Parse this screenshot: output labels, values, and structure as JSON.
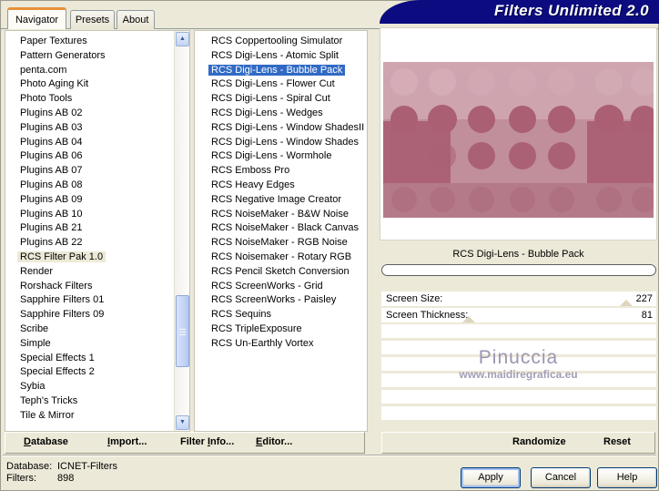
{
  "banner": {
    "title": "Filters Unlimited 2.0"
  },
  "tabs": [
    {
      "label": "Navigator",
      "active": true
    },
    {
      "label": "Presets",
      "active": false
    },
    {
      "label": "About",
      "active": false
    }
  ],
  "categories": {
    "selected": "RCS Filter Pak 1.0",
    "items": [
      "Paper Textures",
      "Pattern Generators",
      "penta.com",
      "Photo Aging Kit",
      "Photo Tools",
      "Plugins AB 02",
      "Plugins AB 03",
      "Plugins AB 04",
      "Plugins AB 06",
      "Plugins AB 07",
      "Plugins AB 08",
      "Plugins AB 09",
      "Plugins AB 10",
      "Plugins AB 21",
      "Plugins AB 22",
      "RCS Filter Pak 1.0",
      "Render",
      "Rorshack Filters",
      "Sapphire Filters 01",
      "Sapphire Filters 09",
      "Scribe",
      "Simple",
      "Special Effects 1",
      "Special Effects 2",
      "Sybia",
      "Teph's Tricks",
      "Tile & Mirror"
    ]
  },
  "filters": {
    "selected": "RCS Digi-Lens - Bubble Pack",
    "items": [
      "RCS Coppertooling Simulator",
      "RCS Digi-Lens - Atomic Split",
      "RCS Digi-Lens - Bubble Pack",
      "RCS Digi-Lens - Flower Cut",
      "RCS Digi-Lens - Spiral Cut",
      "RCS Digi-Lens - Wedges",
      "RCS Digi-Lens - Window ShadesII",
      "RCS Digi-Lens - Window Shades",
      "RCS Digi-Lens - Wormhole",
      "RCS Emboss Pro",
      "RCS Heavy Edges",
      "RCS Negative Image Creator",
      "RCS NoiseMaker - B&W Noise",
      "RCS NoiseMaker - Black Canvas",
      "RCS NoiseMaker - RGB Noise",
      "RCS Noisemaker - Rotary RGB",
      "RCS Pencil Sketch Conversion",
      "RCS ScreenWorks - Grid",
      "RCS ScreenWorks - Paisley",
      "RCS Sequins",
      "RCS TripleExposure",
      "RCS Un-Earthly Vortex"
    ]
  },
  "preview": {
    "filter_name": "RCS Digi-Lens - Bubble Pack",
    "watermark_title": "Pinuccia",
    "watermark_url": "www.maidiregrafica.eu"
  },
  "sliders": [
    {
      "label": "Screen Size:",
      "value": 227,
      "max": 255
    },
    {
      "label": "Screen Thickness:",
      "value": 81,
      "max": 255
    }
  ],
  "toolbar": {
    "database": {
      "label": "Database",
      "underline": 0
    },
    "import": {
      "label": "Import...",
      "underline": 0
    },
    "filter_info": {
      "label": "Filter Info...",
      "underline": 7
    },
    "editor": {
      "label": "Editor...",
      "underline": 0
    },
    "randomize": "Randomize",
    "reset": "Reset"
  },
  "status": {
    "database_label": "Database:",
    "database_value": "ICNET-Filters",
    "filters_label": "Filters:",
    "filters_value": "898"
  },
  "buttons": {
    "apply": "Apply",
    "cancel": "Cancel",
    "help": "Help"
  },
  "colors": {
    "dialog_bg": "#ece9d8",
    "selection_blue": "#316ac5",
    "banner_navy": "#0c0c80",
    "tab_accent_orange": "#e5913a",
    "preview_light_pink": "#cfa5b0",
    "preview_mid_pink": "#c18e9c",
    "preview_dark_rose": "#ac6276",
    "preview_bottom_rose": "#b57a8a",
    "watermark_gray": "#9b96b3"
  }
}
